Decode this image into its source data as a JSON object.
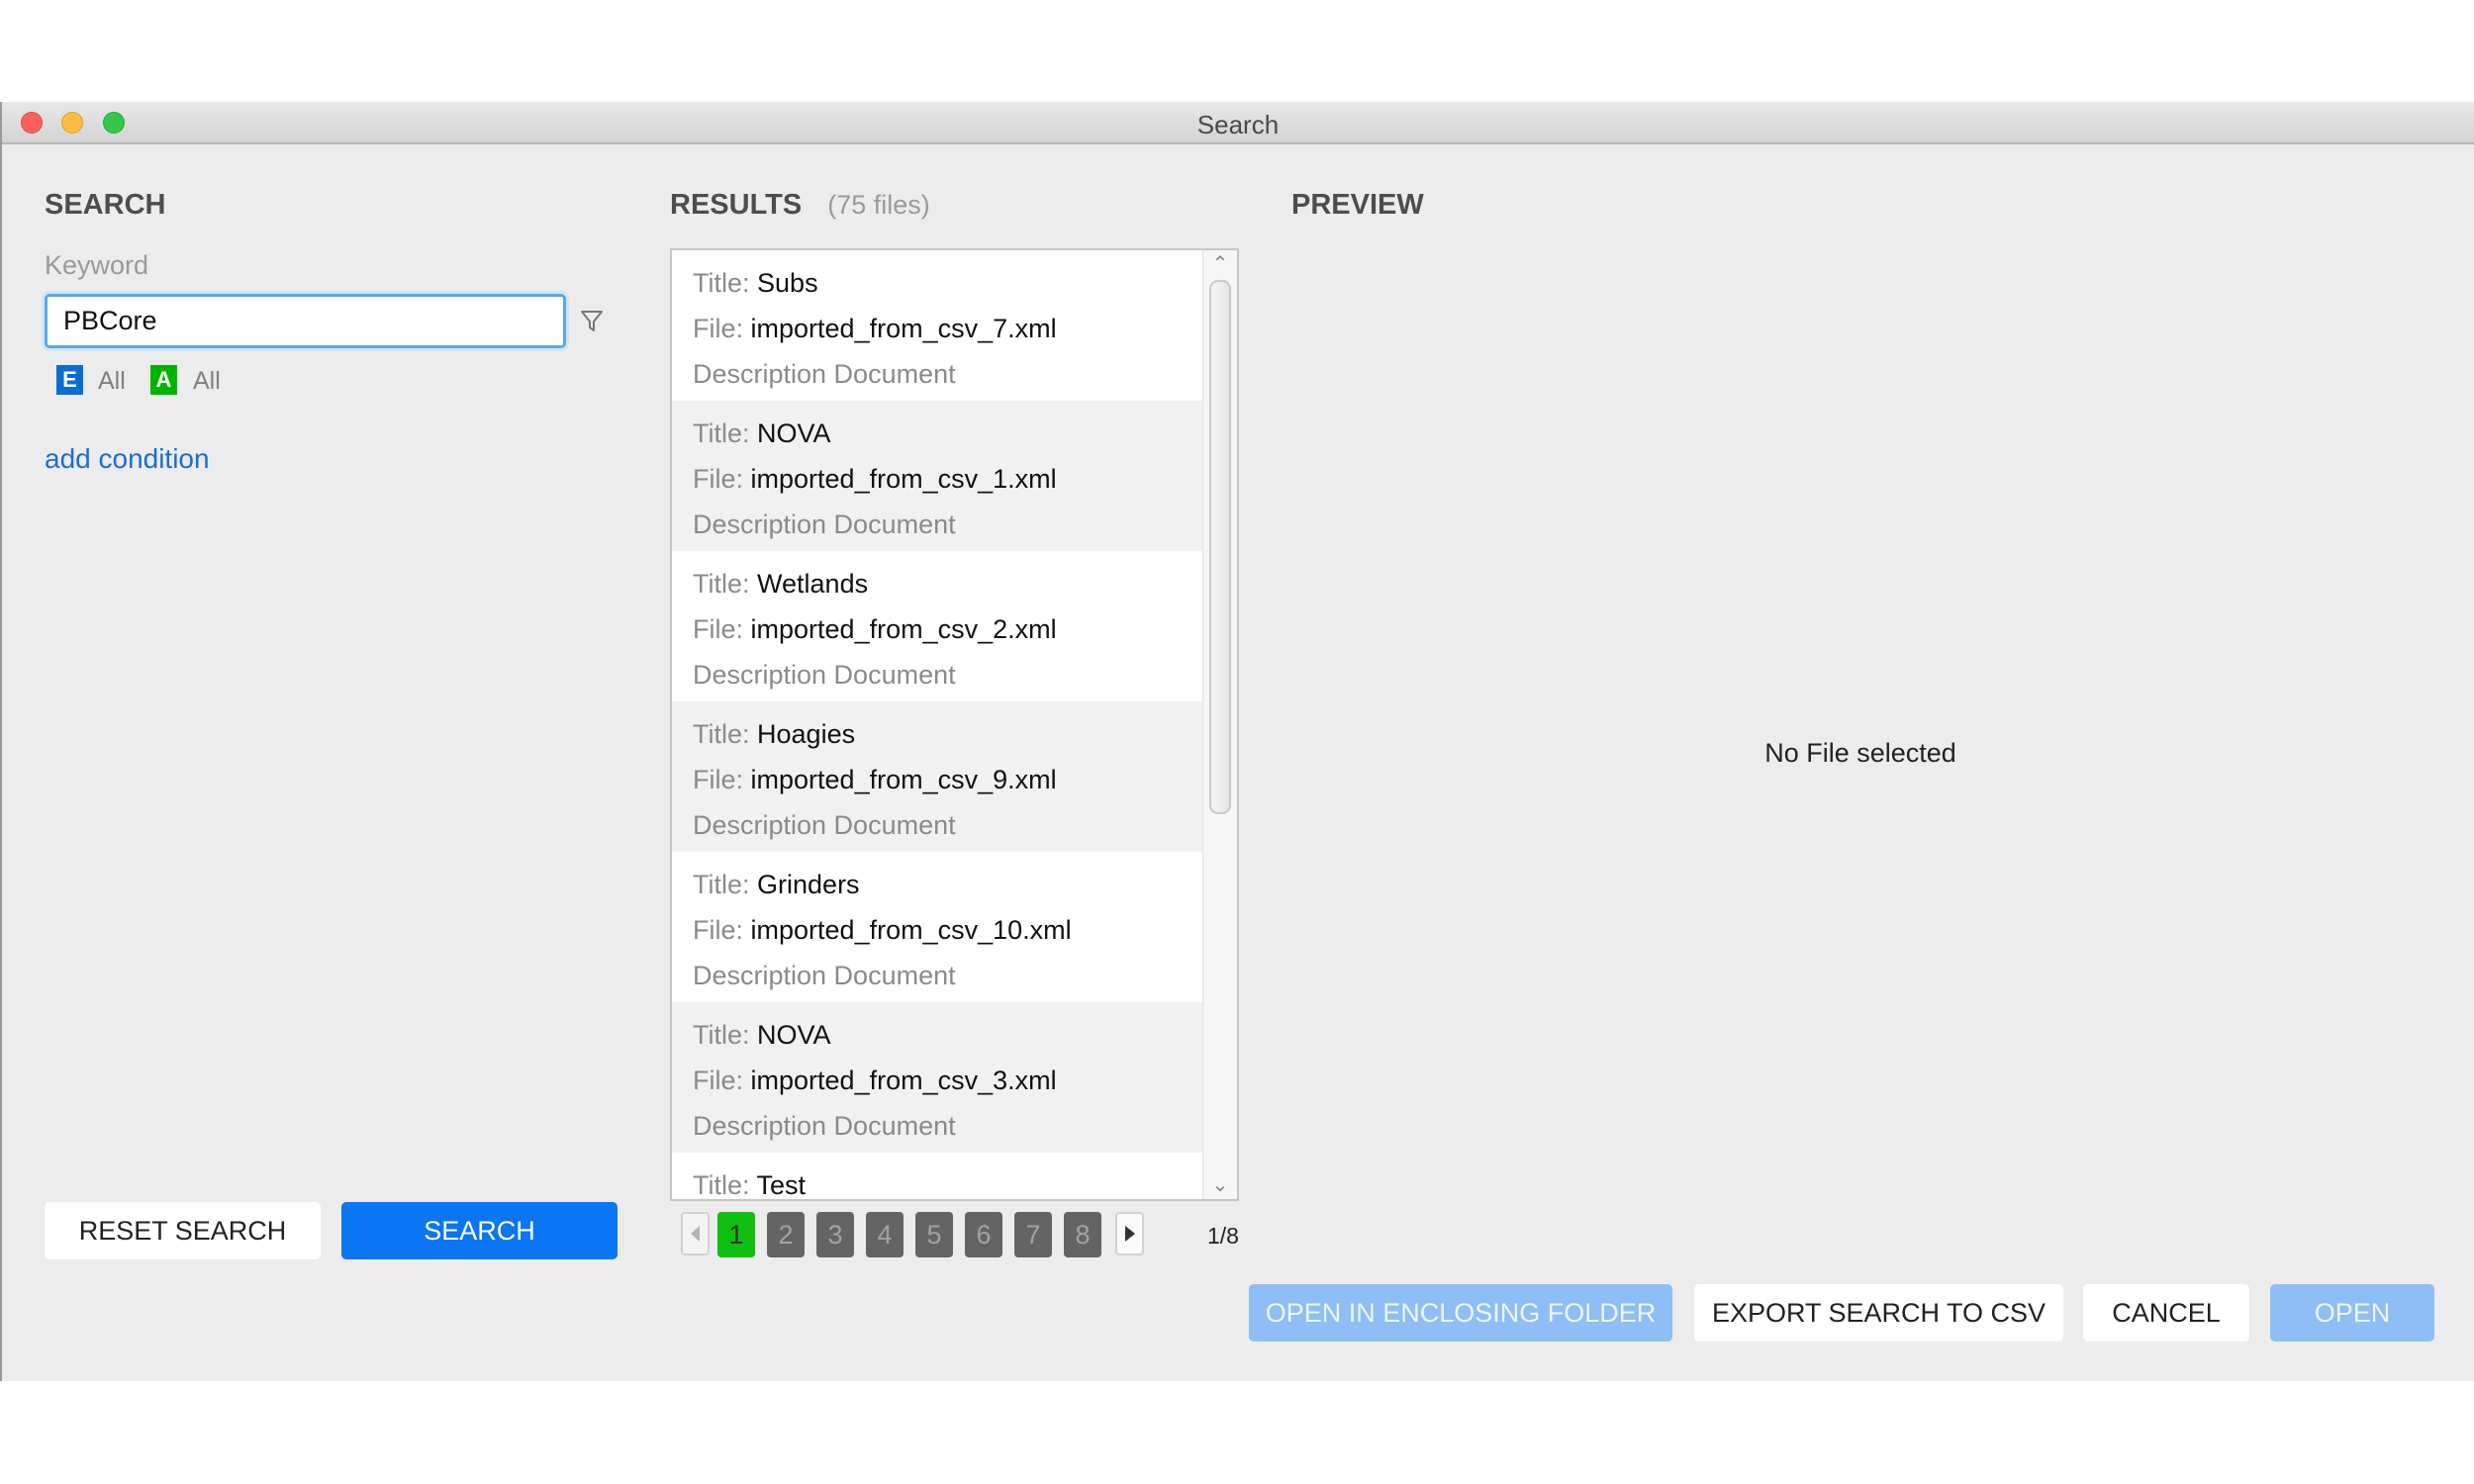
{
  "window": {
    "title": "Search"
  },
  "search_panel": {
    "heading": "SEARCH",
    "keyword_label": "Keyword",
    "keyword_value": "PBCore",
    "filter_icon": "filter-icon",
    "element_badge": {
      "letter": "E",
      "label": "All",
      "color": "#0a6ed1"
    },
    "attribute_badge": {
      "letter": "A",
      "label": "All",
      "color": "#00b400"
    },
    "add_condition": "add condition",
    "reset_button": "RESET SEARCH",
    "search_button": "SEARCH"
  },
  "results_panel": {
    "heading": "RESULTS",
    "count": "(75 files)",
    "title_key": "Title:",
    "file_key": "File:",
    "items": [
      {
        "title": "Subs",
        "file": "imported_from_csv_7.xml",
        "type": "Description Document"
      },
      {
        "title": "NOVA",
        "file": "imported_from_csv_1.xml",
        "type": "Description Document"
      },
      {
        "title": "Wetlands",
        "file": "imported_from_csv_2.xml",
        "type": "Description Document"
      },
      {
        "title": "Hoagies",
        "file": "imported_from_csv_9.xml",
        "type": "Description Document"
      },
      {
        "title": "Grinders",
        "file": "imported_from_csv_10.xml",
        "type": "Description Document"
      },
      {
        "title": "NOVA",
        "file": "imported_from_csv_3.xml",
        "type": "Description Document"
      },
      {
        "title": "Test",
        "file": "",
        "type": ""
      }
    ],
    "pagination": {
      "pages": [
        "1",
        "2",
        "3",
        "4",
        "5",
        "6",
        "7",
        "8"
      ],
      "current": "1",
      "page_count_label": "1/8",
      "active_color": "#10bf10"
    }
  },
  "preview_panel": {
    "heading": "PREVIEW",
    "empty_message": "No File selected"
  },
  "footer": {
    "open_enclosing": "OPEN IN ENCLOSING FOLDER",
    "export_csv": "EXPORT SEARCH TO CSV",
    "cancel": "CANCEL",
    "open": "OPEN"
  }
}
